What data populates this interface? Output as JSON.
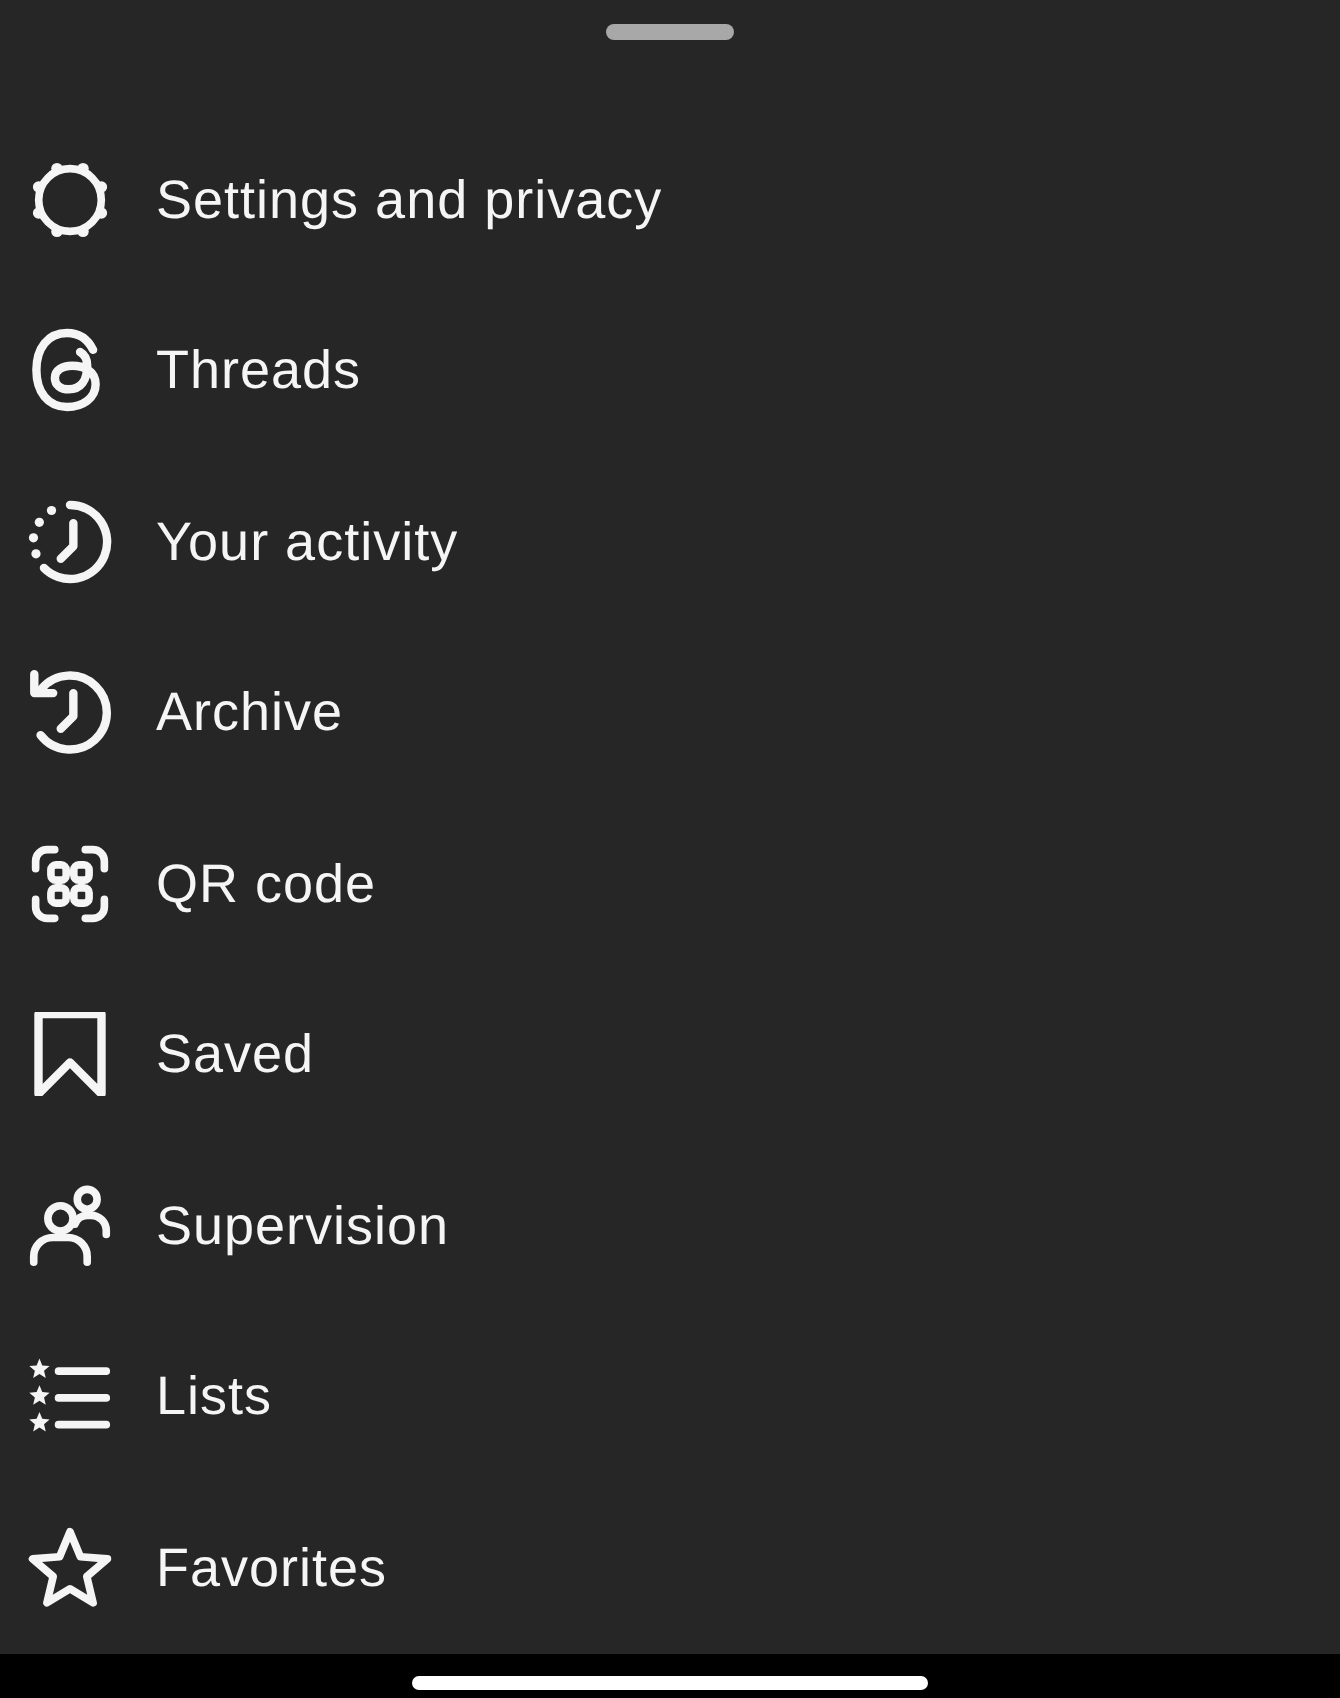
{
  "menu": [
    {
      "kind": "settings",
      "label": "Settings and privacy"
    },
    {
      "kind": "threads",
      "label": "Threads"
    },
    {
      "kind": "activity",
      "label": "Your activity"
    },
    {
      "kind": "archive",
      "label": "Archive"
    },
    {
      "kind": "qr",
      "label": "QR code"
    },
    {
      "kind": "saved",
      "label": "Saved"
    },
    {
      "kind": "supervision",
      "label": "Supervision"
    },
    {
      "kind": "lists",
      "label": "Lists"
    },
    {
      "kind": "favorites",
      "label": "Favorites"
    }
  ]
}
